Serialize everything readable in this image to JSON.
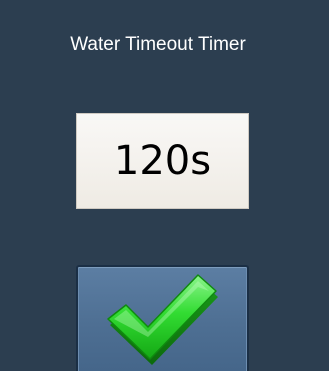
{
  "dialog": {
    "title": "Water Timeout Timer",
    "value": "120s"
  },
  "confirm_button": {
    "icon": "checkmark-icon"
  },
  "colors": {
    "background": "#2c3e50",
    "display_background": "#f5f3ef",
    "button_background": "#5274a0",
    "check_green": "#2ecc2e"
  }
}
